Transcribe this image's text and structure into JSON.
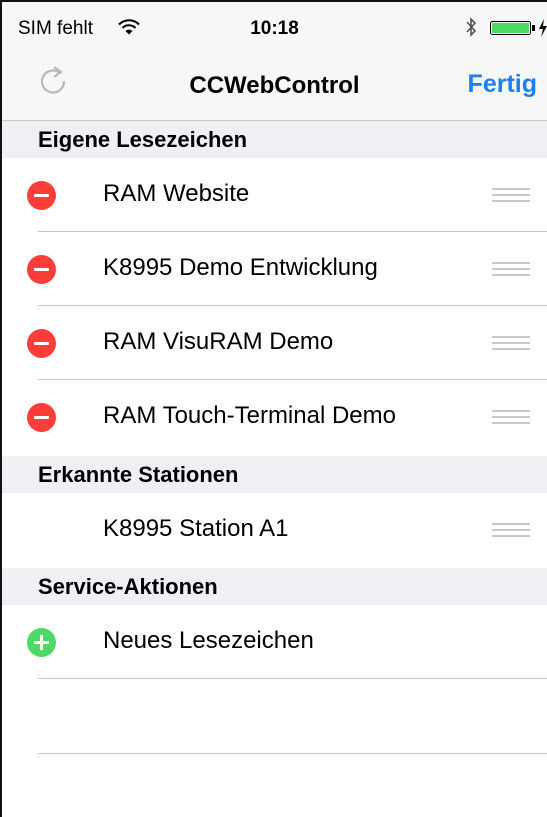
{
  "status": {
    "carrier": "SIM fehlt",
    "time": "10:18"
  },
  "nav": {
    "title": "CCWebControl",
    "done": "Fertig"
  },
  "sections": {
    "bookmarks": {
      "header": "Eigene Lesezeichen",
      "items": [
        {
          "label": "RAM Website"
        },
        {
          "label": "K8995 Demo Entwicklung"
        },
        {
          "label": "RAM VisuRAM Demo"
        },
        {
          "label": "RAM Touch-Terminal Demo"
        }
      ]
    },
    "stations": {
      "header": "Erkannte Stationen",
      "items": [
        {
          "label": "K8995 Station A1"
        }
      ]
    },
    "service": {
      "header": "Service-Aktionen",
      "items": [
        {
          "label": "Neues Lesezeichen"
        }
      ]
    }
  },
  "colors": {
    "accent": "#1a7ff5",
    "delete": "#fc3d39",
    "add": "#4cd964"
  }
}
